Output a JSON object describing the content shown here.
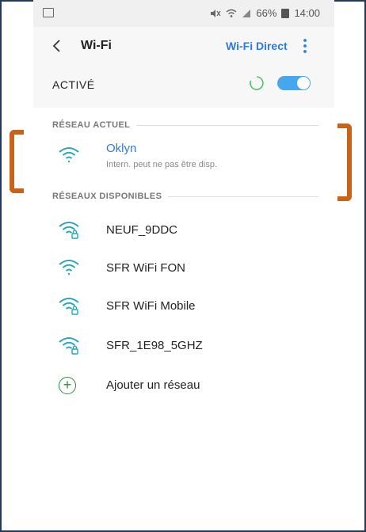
{
  "status_bar": {
    "battery_percent": "66%",
    "time": "14:00"
  },
  "toolbar": {
    "title": "Wi-Fi",
    "wifi_direct_label": "Wi-Fi Direct"
  },
  "master_switch": {
    "label": "ACTIVÉ",
    "enabled": true
  },
  "current_network": {
    "section_title": "RÉSEAU ACTUEL",
    "name": "Oklyn",
    "status": "Intern. peut ne pas être disp."
  },
  "available_networks": {
    "section_title": "RÉSEAUX DISPONIBLES",
    "items": [
      {
        "name": "NEUF_9DDC",
        "secured": true
      },
      {
        "name": "SFR WiFi FON",
        "secured": false
      },
      {
        "name": "SFR WiFi Mobile",
        "secured": true
      },
      {
        "name": "SFR_1E98_5GHZ",
        "secured": true
      }
    ],
    "add_label": "Ajouter un réseau"
  },
  "colors": {
    "accent_blue": "#2f7bd6",
    "toggle_blue": "#46a7ee",
    "wifi_icon": "#25a7b8",
    "add_green": "#2e8b3a",
    "highlight_bracket": "#c9631a"
  },
  "icons": {
    "back": "back-arrow-icon",
    "more": "more-vert-icon",
    "wifi": "wifi-icon",
    "wifi_locked": "wifi-lock-icon",
    "add": "plus-circle-icon"
  }
}
